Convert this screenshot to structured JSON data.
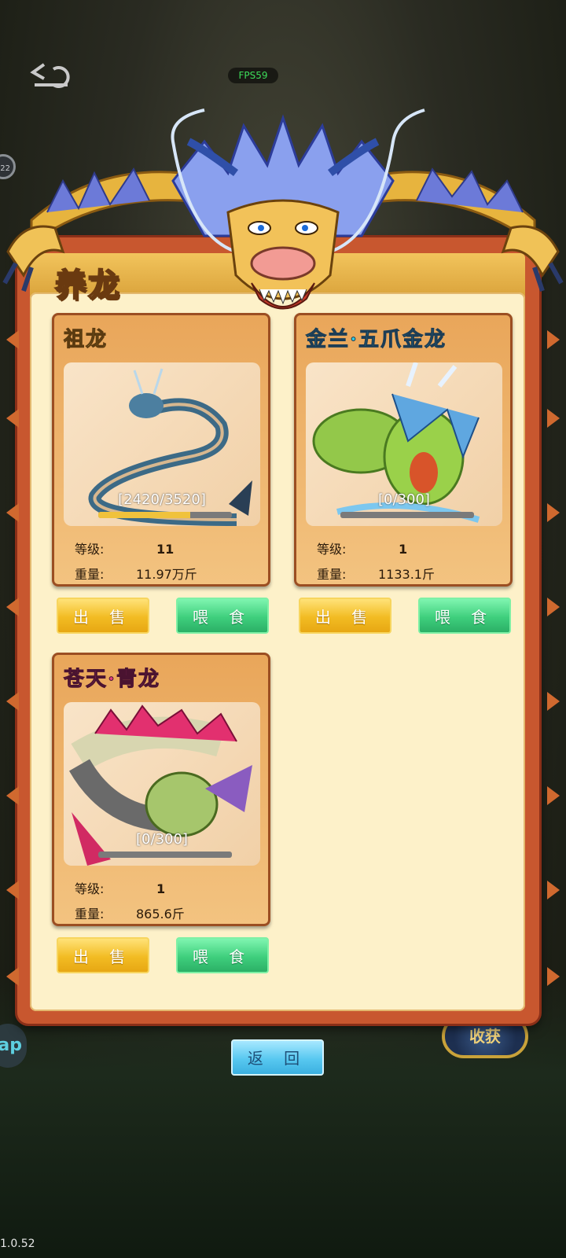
{
  "hud": {
    "fps": "FPS59",
    "left_badge": "22",
    "left_app": "ap",
    "right_medal": "收获",
    "version": "1.0.52"
  },
  "panel": {
    "title": "养龙",
    "back_label": "返 回"
  },
  "dragons": [
    {
      "name_parts": [
        "祖龙"
      ],
      "name_color": "gold",
      "progress_text": "[2420/3520]",
      "progress_fraction": 0.6875,
      "level_label": "等级:",
      "level": "11",
      "weight_label": "重量:",
      "weight": "11.97万斤",
      "sell_label": "出 售",
      "feed_label": "喂 食"
    },
    {
      "name_parts": [
        "金兰·五爪金龙"
      ],
      "name_color": "blue",
      "progress_text": "[0/300]",
      "progress_fraction": 0,
      "level_label": "等级:",
      "level": "1",
      "weight_label": "重量:",
      "weight": "1133.1斤",
      "sell_label": "出 售",
      "feed_label": "喂 食"
    },
    {
      "name_parts": [
        "苍天·青龙"
      ],
      "name_color": "pink",
      "progress_text": "[0/300]",
      "progress_fraction": 0,
      "level_label": "等级:",
      "level": "1",
      "weight_label": "重量:",
      "weight": "865.6斤",
      "sell_label": "出 售",
      "feed_label": "喂 食"
    }
  ]
}
